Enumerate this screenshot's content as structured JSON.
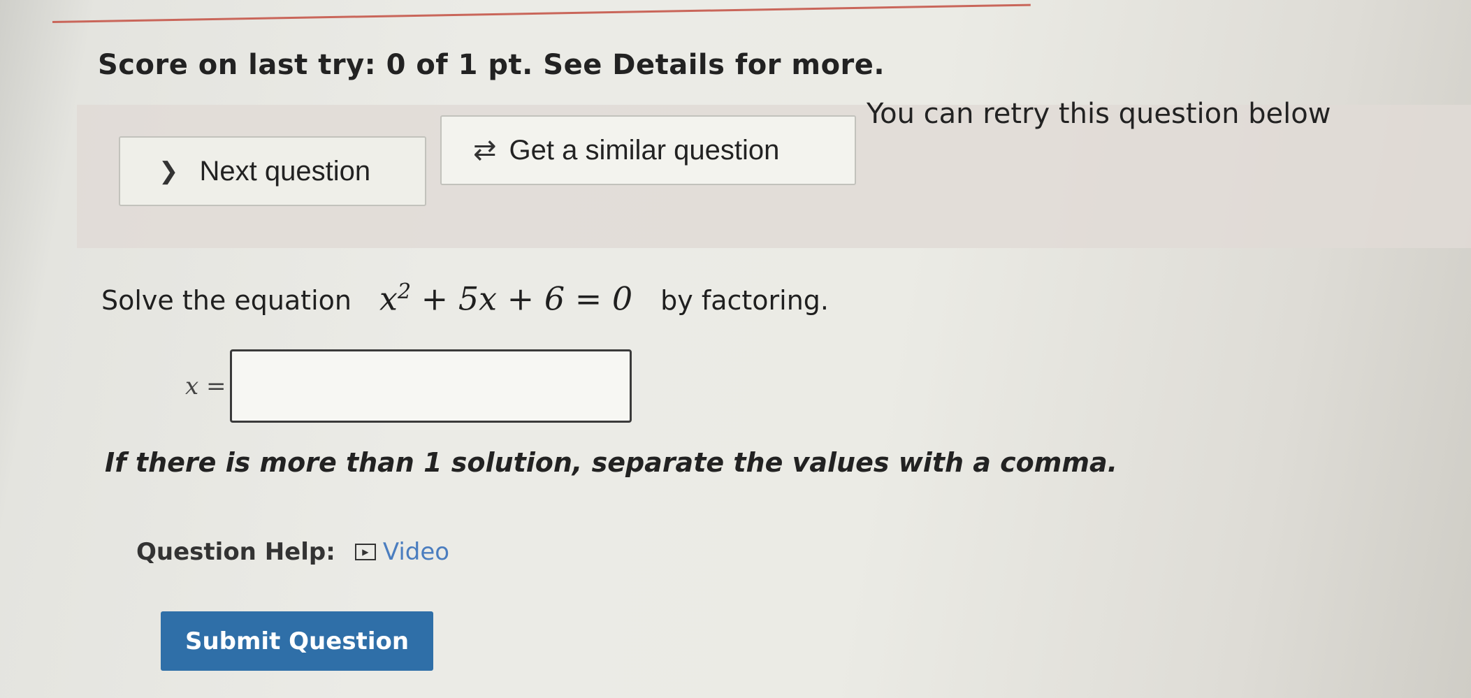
{
  "score": {
    "text": "Score on last try: 0 of 1 pt. See Details for more."
  },
  "actions": {
    "next_label": "Next question",
    "similar_label": "Get a similar question",
    "retry_text": "You can retry this question below"
  },
  "question": {
    "prefix": "Solve the equation",
    "equation_base": "x",
    "equation_exponent": "2",
    "equation_rest": " + 5x + 6 = 0",
    "suffix": "by factoring.",
    "answer_label": "x =",
    "answer_value": "",
    "instruction": "If there is more than 1 solution, separate the values with a comma."
  },
  "help": {
    "label": "Question Help:",
    "video_label": "Video"
  },
  "submit": {
    "label": "Submit Question"
  },
  "icons": {
    "next": "chevron-right-icon",
    "similar": "swap-arrows-icon",
    "video": "play-icon"
  },
  "colors": {
    "submit_bg": "#2f6fa8",
    "link": "#4a7dbf",
    "accent_line": "#c9665a"
  }
}
